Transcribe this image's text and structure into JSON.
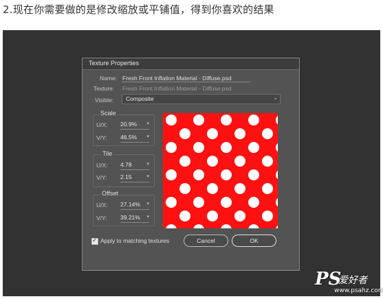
{
  "caption": "2.现在你需要做的是修改缩放或平铺值，得到你喜欢的结果",
  "dialog": {
    "title": "Texture Properties",
    "name_label": "Name:",
    "name_value": "Fresh Front Inflation Material - Diffuse.psd",
    "texture_label": "Texture:",
    "texture_value": "Fresh Front Inflation Material - Diffuse.psd",
    "visible_label": "Visible:",
    "visible_value": "Composite",
    "scale": {
      "title": "Scale",
      "ux_label": "U/X:",
      "ux_value": "20.9%",
      "vy_label": "V/Y:",
      "vy_value": "46.5%"
    },
    "tile": {
      "title": "Tile",
      "ux_label": "U/X:",
      "ux_value": "4.78",
      "vy_label": "V/Y:",
      "vy_value": "2.15"
    },
    "offset": {
      "title": "Offset",
      "ux_label": "U/X:",
      "ux_value": "27.14%",
      "vy_label": "V/Y:",
      "vy_value": "39.21%"
    },
    "apply_label": "Apply to matching textures",
    "apply_checked": true,
    "cancel_label": "Cancel",
    "ok_label": "OK"
  },
  "preview": {
    "background": "#ff1111",
    "dot_color": "#ffffff"
  },
  "watermark": {
    "ps": "PS",
    "cn": "爱好者",
    "url": "www.psahz.com"
  },
  "colors": {
    "backdrop": "#323232",
    "dialog": "#535353"
  }
}
